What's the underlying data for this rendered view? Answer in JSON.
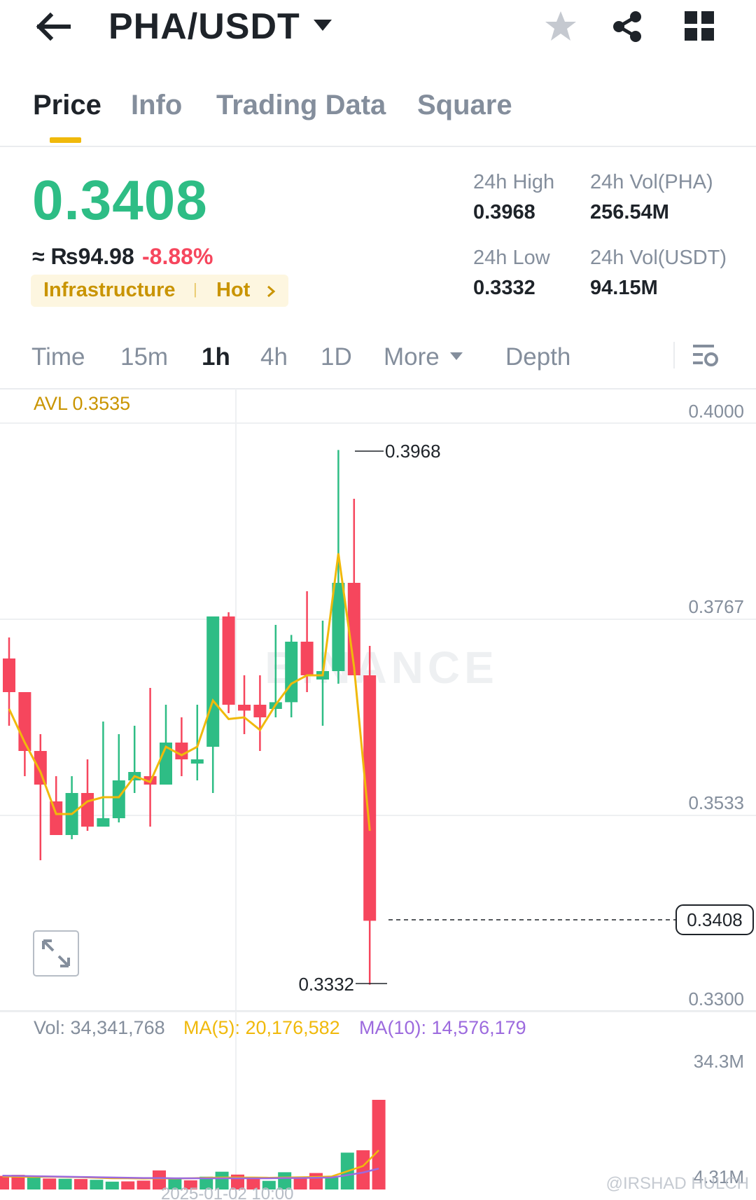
{
  "header": {
    "pair": "PHA/USDT",
    "icons": [
      "back-arrow-icon",
      "caret-down-icon",
      "star-icon",
      "share-icon",
      "grid-icon"
    ]
  },
  "tabs": [
    {
      "label": "Price",
      "active": true
    },
    {
      "label": "Info",
      "active": false
    },
    {
      "label": "Trading Data",
      "active": false
    },
    {
      "label": "Square",
      "active": false
    }
  ],
  "ticker": {
    "last_price": "0.3408",
    "fiat_price": "≈ ₨94.98",
    "change": "-8.88%",
    "tag_category": "Infrastructure",
    "tag_hot": "Hot",
    "high_label": "24h High",
    "high_value": "0.3968",
    "low_label": "24h Low",
    "low_value": "0.3332",
    "vol_base_label": "24h Vol(PHA)",
    "vol_base_value": "256.54M",
    "vol_quote_label": "24h Vol(USDT)",
    "vol_quote_value": "94.15M"
  },
  "colors": {
    "up": "#2ebd85",
    "down": "#f6465d",
    "accent": "#f0b90b",
    "ma5": "#f0b90b",
    "ma10": "#9c6ade"
  },
  "intervals": {
    "items": [
      "Time",
      "15m",
      "1h",
      "4h",
      "1D"
    ],
    "active": "1h",
    "more": "More",
    "depth": "Depth"
  },
  "chart_labels": {
    "avl": "AVL 0.3535",
    "y_ticks": [
      "0.4000",
      "0.3767",
      "0.3533",
      "0.3300"
    ],
    "current_price": "0.3408",
    "high_marker": "0.3968",
    "low_marker": "0.3332",
    "vol_text": "Vol: 34,341,768",
    "ma5_text": "MA(5): 20,176,582",
    "ma10_text": "MA(10): 14,576,179",
    "vol_top": "34.3M",
    "vol_bottom": "4.31M",
    "watermark": "BINANCE",
    "date_label": "2025-01-02 10:00",
    "credit": "@IRSHAD HULCH"
  },
  "chart_data": {
    "type": "candlestick",
    "interval": "1h",
    "y_range": [
      0.33,
      0.4
    ],
    "y_ticks": [
      0.4,
      0.3767,
      0.3533,
      0.33
    ],
    "current_price": 0.3408,
    "candles": [
      {
        "o": 0.372,
        "h": 0.3745,
        "l": 0.364,
        "c": 0.368
      },
      {
        "o": 0.368,
        "h": 0.368,
        "l": 0.358,
        "c": 0.361
      },
      {
        "o": 0.361,
        "h": 0.363,
        "l": 0.348,
        "c": 0.357
      },
      {
        "o": 0.355,
        "h": 0.358,
        "l": 0.352,
        "c": 0.351
      },
      {
        "o": 0.351,
        "h": 0.358,
        "l": 0.3505,
        "c": 0.356
      },
      {
        "o": 0.356,
        "h": 0.36,
        "l": 0.3515,
        "c": 0.352
      },
      {
        "o": 0.352,
        "h": 0.3645,
        "l": 0.352,
        "c": 0.353
      },
      {
        "o": 0.353,
        "h": 0.363,
        "l": 0.3525,
        "c": 0.3575
      },
      {
        "o": 0.3575,
        "h": 0.364,
        "l": 0.356,
        "c": 0.3585
      },
      {
        "o": 0.358,
        "h": 0.3685,
        "l": 0.352,
        "c": 0.357
      },
      {
        "o": 0.357,
        "h": 0.3665,
        "l": 0.357,
        "c": 0.362
      },
      {
        "o": 0.362,
        "h": 0.365,
        "l": 0.358,
        "c": 0.36
      },
      {
        "o": 0.3595,
        "h": 0.3665,
        "l": 0.3575,
        "c": 0.36
      },
      {
        "o": 0.3615,
        "h": 0.376,
        "l": 0.356,
        "c": 0.377
      },
      {
        "o": 0.377,
        "h": 0.3775,
        "l": 0.3655,
        "c": 0.3665
      },
      {
        "o": 0.3665,
        "h": 0.37,
        "l": 0.363,
        "c": 0.3658
      },
      {
        "o": 0.3665,
        "h": 0.37,
        "l": 0.361,
        "c": 0.365
      },
      {
        "o": 0.366,
        "h": 0.376,
        "l": 0.365,
        "c": 0.3668
      },
      {
        "o": 0.3668,
        "h": 0.3748,
        "l": 0.365,
        "c": 0.374
      },
      {
        "o": 0.374,
        "h": 0.38,
        "l": 0.368,
        "c": 0.37
      },
      {
        "o": 0.3695,
        "h": 0.3765,
        "l": 0.364,
        "c": 0.3705
      },
      {
        "o": 0.3705,
        "h": 0.3968,
        "l": 0.369,
        "c": 0.381
      },
      {
        "o": 0.381,
        "h": 0.391,
        "l": 0.37,
        "c": 0.37
      },
      {
        "o": 0.37,
        "h": 0.3735,
        "l": 0.3332,
        "c": 0.3408
      }
    ],
    "ma_line": [
      0.366,
      0.362,
      0.3585,
      0.3535,
      0.3535,
      0.355,
      0.3555,
      0.3555,
      0.358,
      0.3573,
      0.3615,
      0.3605,
      0.3615,
      0.367,
      0.3648,
      0.365,
      0.3635,
      0.3665,
      0.369,
      0.37,
      0.37,
      0.3845,
      0.371,
      0.3515
    ],
    "volume": {
      "values_m": [
        5.2,
        5.6,
        5.0,
        4.2,
        4.1,
        4.0,
        3.7,
        3.0,
        3.1,
        3.4,
        7.3,
        4.1,
        3.5,
        4.9,
        6.8,
        5.7,
        4.2,
        3.3,
        6.6,
        4.3,
        6.3,
        4.6,
        14.1,
        15.0,
        34.3
      ],
      "up": [
        false,
        false,
        true,
        false,
        true,
        false,
        true,
        true,
        false,
        false,
        false,
        true,
        false,
        true,
        true,
        false,
        false,
        true,
        true,
        false,
        false,
        true,
        true,
        false,
        false
      ],
      "ma5_m": [
        5.0,
        4.9,
        4.8,
        4.9,
        4.8,
        4.7,
        4.5,
        4.3,
        4.3,
        4.2,
        4.3,
        4.2,
        4.3,
        4.5,
        4.6,
        4.6,
        4.6,
        4.5,
        4.6,
        4.7,
        4.8,
        5.0,
        7.0,
        9.0,
        15.0
      ],
      "ma10_m": [
        5.3,
        5.2,
        5.1,
        5.0,
        4.9,
        4.8,
        4.7,
        4.6,
        4.5,
        4.4,
        4.4,
        4.3,
        4.3,
        4.3,
        4.3,
        4.3,
        4.3,
        4.3,
        4.4,
        4.4,
        4.5,
        4.6,
        5.5,
        6.5,
        8.0
      ]
    }
  }
}
